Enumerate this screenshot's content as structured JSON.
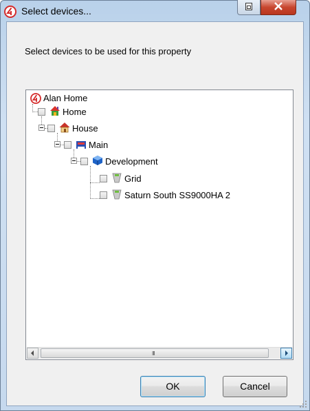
{
  "window": {
    "title": "Select devices...",
    "icons": {
      "app": "control4-logo-icon",
      "restore": "restore-window-icon",
      "close": "close-x-icon"
    },
    "colors": {
      "accent": "#c8472f",
      "titlebar": "#b9d1ea"
    }
  },
  "dialog": {
    "instructions": "Select devices to be used for this property",
    "ok_label": "OK",
    "cancel_label": "Cancel"
  },
  "tree": {
    "root_label": "Alan Home",
    "nodes": [
      {
        "label": "Home",
        "icon": "home-colorful-icon",
        "checked": false,
        "expanded": true
      },
      {
        "label": "House",
        "icon": "house-icon",
        "checked": false,
        "expanded": true
      },
      {
        "label": "Main",
        "icon": "floor-bed-icon",
        "checked": false,
        "expanded": true
      },
      {
        "label": "Development",
        "icon": "cube-room-icon",
        "checked": false,
        "expanded": true
      },
      {
        "label": "Grid",
        "icon": "meter-device-icon",
        "checked": false
      },
      {
        "label": "Saturn South SS9000HA 2",
        "icon": "meter-device-icon",
        "checked": false
      }
    ],
    "scrollbar_grip": "III"
  }
}
